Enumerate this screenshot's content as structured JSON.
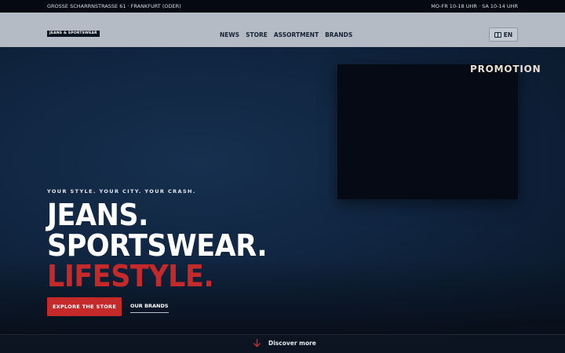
{
  "topbar": {
    "address": "GROSSE SCHARRNSTRASSE 61 · FRANKFURT (ODER)",
    "hours": "MO-FR 10-18 UHR · SA 10-14 UHR"
  },
  "header": {
    "logo_text": "JEANS & SPORTSWEAR",
    "nav": [
      "NEWS",
      "STORE",
      "ASSORTMENT",
      "BRANDS"
    ],
    "language": "EN",
    "language_icon": "globe-icon"
  },
  "hero": {
    "promo_label": "PROMOTION",
    "tagline": "YOUR STYLE. YOUR CITY. YOUR CRASH.",
    "headline_1": "JEANS.",
    "headline_2": "SPORTSWEAR.",
    "headline_3": "LIFESTYLE.",
    "primary_cta": "EXPLORE THE STORE",
    "secondary_cta": "OUR BRANDS"
  },
  "footer_strip": {
    "discover_label": "Discover more",
    "discover_icon": "arrow-down-icon"
  },
  "colors": {
    "accent_red": "#c52a2a",
    "navy": "#0f2138",
    "nav_bg": "#b4bbc4"
  }
}
